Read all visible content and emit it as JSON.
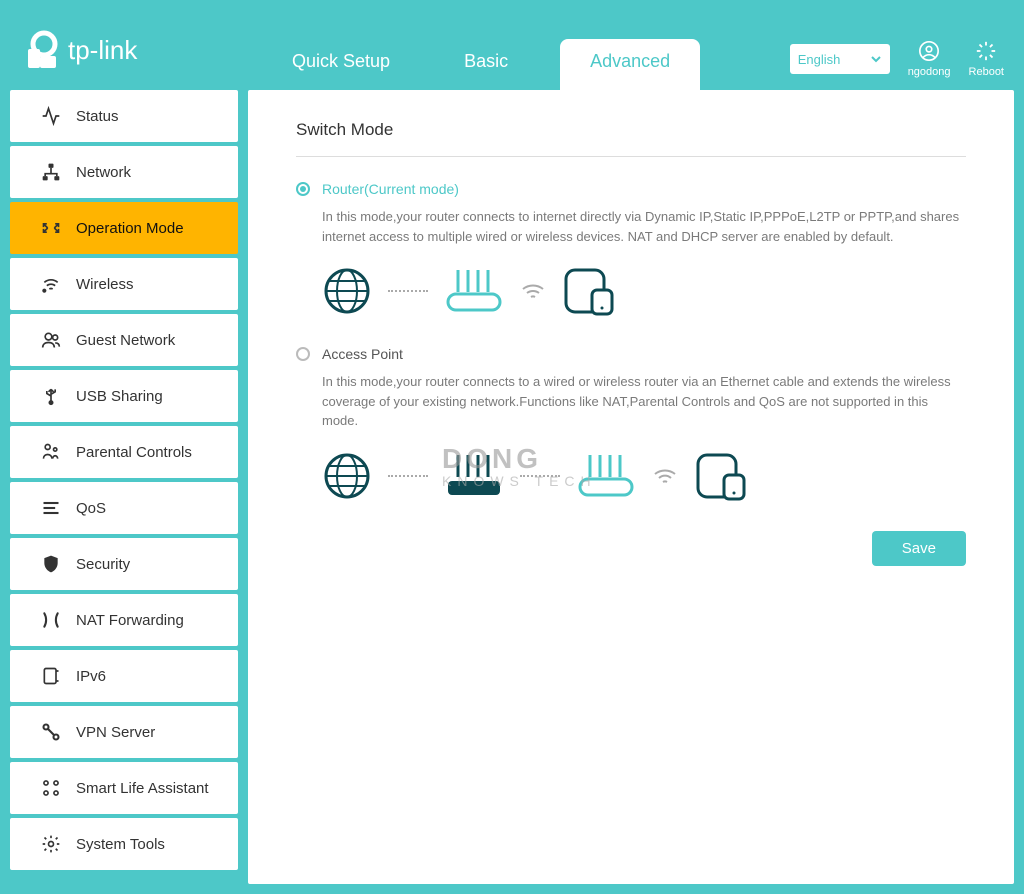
{
  "brand": "tp-link",
  "tabs": {
    "quick_setup": "Quick Setup",
    "basic": "Basic",
    "advanced": "Advanced"
  },
  "header": {
    "language": "English",
    "user": "ngodong",
    "reboot": "Reboot"
  },
  "sidebar": {
    "items": [
      "Status",
      "Network",
      "Operation Mode",
      "Wireless",
      "Guest Network",
      "USB Sharing",
      "Parental Controls",
      "QoS",
      "Security",
      "NAT Forwarding",
      "IPv6",
      "VPN Server",
      "Smart Life Assistant",
      "System Tools"
    ]
  },
  "page": {
    "title": "Switch Mode",
    "mode_router": {
      "label": "Router(Current mode)",
      "desc": "In this mode,your router connects to internet directly via Dynamic IP,Static IP,PPPoE,L2TP or PPTP,and shares internet access to multiple wired or wireless devices. NAT and DHCP server are enabled by default."
    },
    "mode_ap": {
      "label": "Access Point",
      "desc": "In this mode,your router connects to a wired or wireless router via an Ethernet cable and extends the wireless coverage of your existing network.Functions like NAT,Parental Controls and QoS are not supported in this mode."
    },
    "save": "Save"
  },
  "watermark": {
    "line1": "DONG",
    "line2": "KNOWS TECH"
  }
}
